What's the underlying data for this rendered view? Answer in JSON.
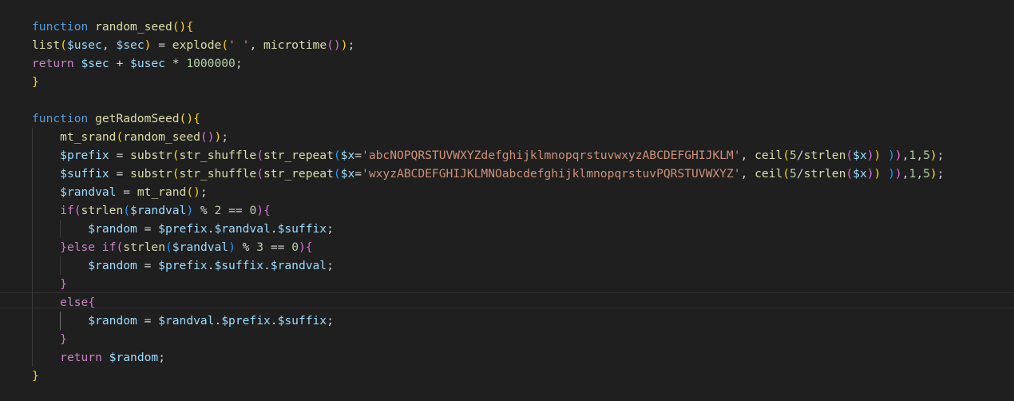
{
  "colors": {
    "background": "#1f1f1f",
    "keyword": "#c586c0",
    "declaration": "#569cd6",
    "function": "#dcdcaa",
    "variable": "#9cdcfe",
    "string": "#ce9178",
    "number": "#b5cea8",
    "plain": "#d4d4d4",
    "bracket1": "#ffd700",
    "bracket2": "#da70d6",
    "bracket3": "#179fff"
  },
  "editor": {
    "lines": [
      {
        "indent": 0,
        "tokens": [
          {
            "t": "function",
            "c": "declaration"
          },
          {
            "t": " ",
            "c": "plain"
          },
          {
            "t": "random_seed",
            "c": "function"
          },
          {
            "t": "()",
            "c": "bracket1"
          },
          {
            "t": "{",
            "c": "bracket1"
          }
        ]
      },
      {
        "indent": 0,
        "tokens": [
          {
            "t": "list",
            "c": "function"
          },
          {
            "t": "(",
            "c": "bracket1"
          },
          {
            "t": "$usec",
            "c": "variable"
          },
          {
            "t": ", ",
            "c": "plain"
          },
          {
            "t": "$sec",
            "c": "variable"
          },
          {
            "t": ")",
            "c": "bracket1"
          },
          {
            "t": " = ",
            "c": "plain"
          },
          {
            "t": "explode",
            "c": "function"
          },
          {
            "t": "(",
            "c": "bracket1"
          },
          {
            "t": "' '",
            "c": "string"
          },
          {
            "t": ", ",
            "c": "plain"
          },
          {
            "t": "microtime",
            "c": "function"
          },
          {
            "t": "()",
            "c": "bracket2"
          },
          {
            "t": ")",
            "c": "bracket1"
          },
          {
            "t": ";",
            "c": "plain"
          }
        ]
      },
      {
        "indent": 0,
        "tokens": [
          {
            "t": "return",
            "c": "keyword"
          },
          {
            "t": " ",
            "c": "plain"
          },
          {
            "t": "$sec",
            "c": "variable"
          },
          {
            "t": " + ",
            "c": "plain"
          },
          {
            "t": "$usec",
            "c": "variable"
          },
          {
            "t": " * ",
            "c": "plain"
          },
          {
            "t": "1000000",
            "c": "number"
          },
          {
            "t": ";",
            "c": "plain"
          }
        ]
      },
      {
        "indent": 0,
        "tokens": [
          {
            "t": "}",
            "c": "bracket1"
          }
        ]
      },
      {
        "indent": 0,
        "tokens": []
      },
      {
        "indent": 0,
        "tokens": [
          {
            "t": "function",
            "c": "declaration"
          },
          {
            "t": " ",
            "c": "plain"
          },
          {
            "t": "getRadomSeed",
            "c": "function"
          },
          {
            "t": "()",
            "c": "bracket1"
          },
          {
            "t": "{",
            "c": "bracket1"
          }
        ]
      },
      {
        "indent": 1,
        "tokens": [
          {
            "t": "mt_srand",
            "c": "function"
          },
          {
            "t": "(",
            "c": "bracket1"
          },
          {
            "t": "random_seed",
            "c": "function"
          },
          {
            "t": "()",
            "c": "bracket2"
          },
          {
            "t": ")",
            "c": "bracket1"
          },
          {
            "t": ";",
            "c": "plain"
          }
        ]
      },
      {
        "indent": 1,
        "tokens": [
          {
            "t": "$prefix",
            "c": "variable"
          },
          {
            "t": " = ",
            "c": "plain"
          },
          {
            "t": "substr",
            "c": "function"
          },
          {
            "t": "(",
            "c": "bracket1"
          },
          {
            "t": "str_shuffle",
            "c": "function"
          },
          {
            "t": "(",
            "c": "bracket2"
          },
          {
            "t": "str_repeat",
            "c": "function"
          },
          {
            "t": "(",
            "c": "bracket3"
          },
          {
            "t": "$x",
            "c": "variable"
          },
          {
            "t": "=",
            "c": "plain"
          },
          {
            "t": "'abcNOPQRSTUVWXYZdefghijklmnopqrstuvwxyzABCDEFGHIJKLM'",
            "c": "string"
          },
          {
            "t": ", ",
            "c": "plain"
          },
          {
            "t": "ceil",
            "c": "function"
          },
          {
            "t": "(",
            "c": "bracket1"
          },
          {
            "t": "5",
            "c": "number"
          },
          {
            "t": "/",
            "c": "plain"
          },
          {
            "t": "strlen",
            "c": "function"
          },
          {
            "t": "(",
            "c": "bracket2"
          },
          {
            "t": "$x",
            "c": "variable"
          },
          {
            "t": ")",
            "c": "bracket2"
          },
          {
            "t": ")",
            "c": "bracket1"
          },
          {
            "t": " ",
            "c": "plain"
          },
          {
            "t": ")",
            "c": "bracket3"
          },
          {
            "t": ")",
            "c": "bracket2"
          },
          {
            "t": ",",
            "c": "plain"
          },
          {
            "t": "1",
            "c": "number"
          },
          {
            "t": ",",
            "c": "plain"
          },
          {
            "t": "5",
            "c": "number"
          },
          {
            "t": ")",
            "c": "bracket1"
          },
          {
            "t": ";",
            "c": "plain"
          }
        ]
      },
      {
        "indent": 1,
        "tokens": [
          {
            "t": "$suffix",
            "c": "variable"
          },
          {
            "t": " = ",
            "c": "plain"
          },
          {
            "t": "substr",
            "c": "function"
          },
          {
            "t": "(",
            "c": "bracket1"
          },
          {
            "t": "str_shuffle",
            "c": "function"
          },
          {
            "t": "(",
            "c": "bracket2"
          },
          {
            "t": "str_repeat",
            "c": "function"
          },
          {
            "t": "(",
            "c": "bracket3"
          },
          {
            "t": "$x",
            "c": "variable"
          },
          {
            "t": "=",
            "c": "plain"
          },
          {
            "t": "'wxyzABCDEFGHIJKLMNOabcdefghijklmnopqrstuvPQRSTUVWXYZ'",
            "c": "string"
          },
          {
            "t": ", ",
            "c": "plain"
          },
          {
            "t": "ceil",
            "c": "function"
          },
          {
            "t": "(",
            "c": "bracket1"
          },
          {
            "t": "5",
            "c": "number"
          },
          {
            "t": "/",
            "c": "plain"
          },
          {
            "t": "strlen",
            "c": "function"
          },
          {
            "t": "(",
            "c": "bracket2"
          },
          {
            "t": "$x",
            "c": "variable"
          },
          {
            "t": ")",
            "c": "bracket2"
          },
          {
            "t": ")",
            "c": "bracket1"
          },
          {
            "t": " ",
            "c": "plain"
          },
          {
            "t": ")",
            "c": "bracket3"
          },
          {
            "t": ")",
            "c": "bracket2"
          },
          {
            "t": ",",
            "c": "plain"
          },
          {
            "t": "1",
            "c": "number"
          },
          {
            "t": ",",
            "c": "plain"
          },
          {
            "t": "5",
            "c": "number"
          },
          {
            "t": ")",
            "c": "bracket1"
          },
          {
            "t": ";",
            "c": "plain"
          }
        ]
      },
      {
        "indent": 1,
        "tokens": [
          {
            "t": "$randval",
            "c": "variable"
          },
          {
            "t": " = ",
            "c": "plain"
          },
          {
            "t": "mt_rand",
            "c": "function"
          },
          {
            "t": "()",
            "c": "bracket1"
          },
          {
            "t": ";",
            "c": "plain"
          }
        ]
      },
      {
        "indent": 1,
        "tokens": [
          {
            "t": "if",
            "c": "keyword"
          },
          {
            "t": "(",
            "c": "bracket2"
          },
          {
            "t": "strlen",
            "c": "function"
          },
          {
            "t": "(",
            "c": "bracket3"
          },
          {
            "t": "$randval",
            "c": "variable"
          },
          {
            "t": ")",
            "c": "bracket3"
          },
          {
            "t": " % ",
            "c": "plain"
          },
          {
            "t": "2",
            "c": "number"
          },
          {
            "t": " == ",
            "c": "plain"
          },
          {
            "t": "0",
            "c": "number"
          },
          {
            "t": ")",
            "c": "bracket2"
          },
          {
            "t": "{",
            "c": "bracket2"
          }
        ]
      },
      {
        "indent": 2,
        "tokens": [
          {
            "t": "$random",
            "c": "variable"
          },
          {
            "t": " = ",
            "c": "plain"
          },
          {
            "t": "$prefix",
            "c": "variable"
          },
          {
            "t": ".",
            "c": "plain"
          },
          {
            "t": "$randval",
            "c": "variable"
          },
          {
            "t": ".",
            "c": "plain"
          },
          {
            "t": "$suffix",
            "c": "variable"
          },
          {
            "t": ";",
            "c": "plain"
          }
        ]
      },
      {
        "indent": 1,
        "tokens": [
          {
            "t": "}",
            "c": "bracket2"
          },
          {
            "t": "else",
            "c": "keyword"
          },
          {
            "t": " ",
            "c": "plain"
          },
          {
            "t": "if",
            "c": "keyword"
          },
          {
            "t": "(",
            "c": "bracket2"
          },
          {
            "t": "strlen",
            "c": "function"
          },
          {
            "t": "(",
            "c": "bracket3"
          },
          {
            "t": "$randval",
            "c": "variable"
          },
          {
            "t": ")",
            "c": "bracket3"
          },
          {
            "t": " % ",
            "c": "plain"
          },
          {
            "t": "3",
            "c": "number"
          },
          {
            "t": " == ",
            "c": "plain"
          },
          {
            "t": "0",
            "c": "number"
          },
          {
            "t": ")",
            "c": "bracket2"
          },
          {
            "t": "{",
            "c": "bracket2"
          }
        ]
      },
      {
        "indent": 2,
        "tokens": [
          {
            "t": "$random",
            "c": "variable"
          },
          {
            "t": " = ",
            "c": "plain"
          },
          {
            "t": "$prefix",
            "c": "variable"
          },
          {
            "t": ".",
            "c": "plain"
          },
          {
            "t": "$suffix",
            "c": "variable"
          },
          {
            "t": ".",
            "c": "plain"
          },
          {
            "t": "$randval",
            "c": "variable"
          },
          {
            "t": ";",
            "c": "plain"
          }
        ]
      },
      {
        "indent": 1,
        "tokens": [
          {
            "t": "}",
            "c": "bracket2"
          }
        ]
      },
      {
        "indent": 1,
        "tokens": [
          {
            "t": "else",
            "c": "keyword"
          },
          {
            "t": "{",
            "c": "bracket2"
          }
        ]
      },
      {
        "indent": 2,
        "tokens": [
          {
            "t": "$random",
            "c": "variable"
          },
          {
            "t": " = ",
            "c": "plain"
          },
          {
            "t": "$randval",
            "c": "variable"
          },
          {
            "t": ".",
            "c": "plain"
          },
          {
            "t": "$prefix",
            "c": "variable"
          },
          {
            "t": ".",
            "c": "plain"
          },
          {
            "t": "$suffix",
            "c": "variable"
          },
          {
            "t": ";",
            "c": "plain"
          }
        ]
      },
      {
        "indent": 1,
        "tokens": [
          {
            "t": "}",
            "c": "bracket2"
          }
        ]
      },
      {
        "indent": 1,
        "tokens": [
          {
            "t": "return",
            "c": "keyword"
          },
          {
            "t": " ",
            "c": "plain"
          },
          {
            "t": "$random",
            "c": "variable"
          },
          {
            "t": ";",
            "c": "plain"
          }
        ]
      },
      {
        "indent": 0,
        "tokens": [
          {
            "t": "}",
            "c": "bracket1"
          }
        ]
      }
    ]
  }
}
